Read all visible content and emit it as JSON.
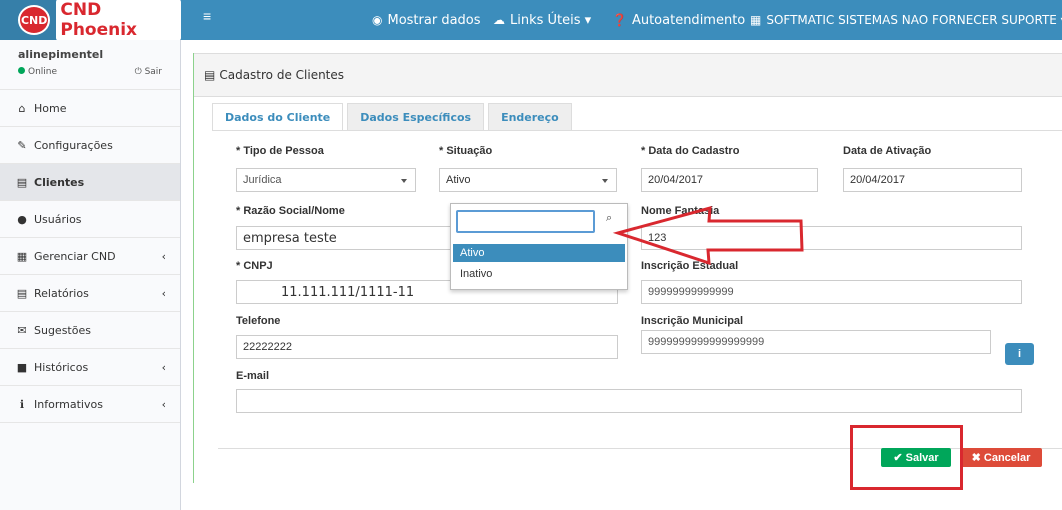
{
  "app": {
    "logo_badge": "CND",
    "logo_text": "CND Phoenix"
  },
  "topnav": {
    "menu_toggle": "≡",
    "show_data": "Mostrar dados",
    "links": "Links Úteis ▾",
    "support": "Autoatendimento",
    "company": "SOFTMATIC SISTEMAS NAO FORNECER SUPORTE ▾"
  },
  "user": {
    "name": "alinepimentel",
    "status": "Online",
    "logout": "Sair"
  },
  "sidebar": {
    "items": [
      {
        "label": "Home",
        "icon": "⌂",
        "chevron": ""
      },
      {
        "label": "Configurações",
        "icon": "✎",
        "chevron": ""
      },
      {
        "label": "Clientes",
        "icon": "▤",
        "chevron": ""
      },
      {
        "label": "Usuários",
        "icon": "●",
        "chevron": ""
      },
      {
        "label": "Gerenciar CND",
        "icon": "▦",
        "chevron": "‹"
      },
      {
        "label": "Relatórios",
        "icon": "▤",
        "chevron": "‹"
      },
      {
        "label": "Sugestões",
        "icon": "✉",
        "chevron": ""
      },
      {
        "label": "Históricos",
        "icon": "■",
        "chevron": "‹"
      },
      {
        "label": "Informativos",
        "icon": "ℹ",
        "chevron": "‹"
      }
    ]
  },
  "page": {
    "title": "Cadastro de Clientes",
    "title_icon": "▤"
  },
  "tabs": [
    "Dados do Cliente",
    "Dados Específicos",
    "Endereço"
  ],
  "form": {
    "tipo_pessoa": {
      "label": "* Tipo de Pessoa",
      "value": "Jurídica"
    },
    "situacao": {
      "label": "* Situação",
      "value": "Ativo",
      "options": [
        "Ativo",
        "Inativo"
      ],
      "search_value": ""
    },
    "data_cadastro": {
      "label": "* Data do Cadastro",
      "value": "20/04/2017"
    },
    "data_ativacao": {
      "label": "Data de Ativação",
      "value": "20/04/2017"
    },
    "razao_social": {
      "label": "* Razão Social/Nome",
      "value": "empresa teste"
    },
    "nome_fantasia": {
      "label": "Nome Fantasia",
      "value": "123"
    },
    "cnpj": {
      "label": "* CNPJ",
      "value": "11.111.111/1111-11"
    },
    "inscricao_estadual": {
      "label": "Inscrição Estadual",
      "value": "99999999999999"
    },
    "telefone": {
      "label": "Telefone",
      "value": "22222222"
    },
    "inscricao_municipal": {
      "label": "Inscrição Municipal",
      "value": "9999999999999999999"
    },
    "email": {
      "label": "E-mail",
      "value": ""
    }
  },
  "actions": {
    "save": "✔  Salvar",
    "cancel": "✖  Cancelar"
  },
  "colors": {
    "header": "#3c8dbc",
    "brand": "#d9282f",
    "save": "#00a65a",
    "cancel": "#dd4b39",
    "annotation": "#d9282f"
  }
}
